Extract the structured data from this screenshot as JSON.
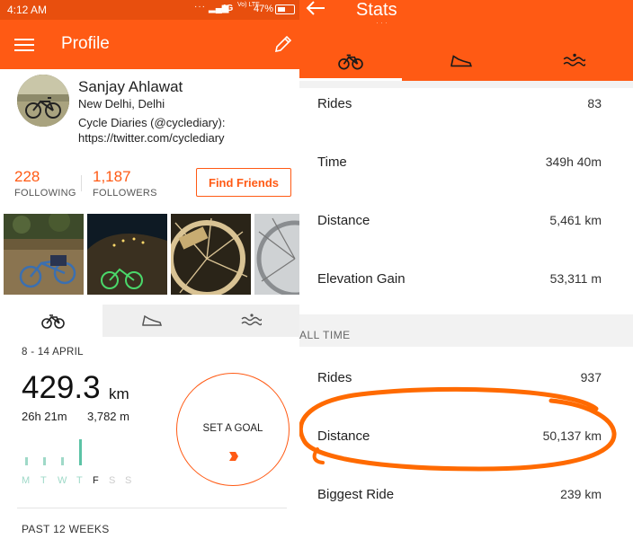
{
  "status_bar": {
    "time": "4:12 AM",
    "network": "4G",
    "volte": "Vo) LTE",
    "battery": "47%"
  },
  "profile_screen": {
    "title": "Profile",
    "athlete": {
      "name": "Sanjay Ahlawat",
      "location": "New Delhi, Delhi",
      "bio_line1": "Cycle Diaries (@cyclediary):",
      "bio_line2": "https://twitter.com/cyclediary"
    },
    "following": {
      "count": "228",
      "label": "FOLLOWING"
    },
    "followers": {
      "count": "1,187",
      "label": "FOLLOWERS"
    },
    "find_friends_label": "Find Friends",
    "activity_tabs": [
      {
        "icon": "bike-icon",
        "selected": true
      },
      {
        "icon": "shoe-icon",
        "selected": false
      },
      {
        "icon": "swim-icon",
        "selected": false
      }
    ],
    "week": {
      "range": "8 - 14 APRIL",
      "distance": "429.3",
      "distance_unit": "km",
      "moving_time": "26h 21m",
      "elevation": "3,782 m",
      "days": [
        "M",
        "T",
        "W",
        "T",
        "F",
        "S",
        "S"
      ],
      "goal_label": "SET A GOAL"
    },
    "past_weeks_label": "PAST 12 WEEKS"
  },
  "stats_screen": {
    "title": "Stats",
    "tabs": [
      {
        "icon": "bike-icon",
        "selected": true
      },
      {
        "icon": "shoe-icon",
        "selected": false
      },
      {
        "icon": "swim-icon",
        "selected": false
      }
    ],
    "recent": [
      {
        "label": "Rides",
        "value": "83"
      },
      {
        "label": "Time",
        "value": "349h 40m"
      },
      {
        "label": "Distance",
        "value": "5,461 km"
      },
      {
        "label": "Elevation Gain",
        "value": "53,311 m"
      }
    ],
    "all_time_title": "ALL TIME",
    "all_time": [
      {
        "label": "Rides",
        "value": "937"
      },
      {
        "label": "Distance",
        "value": "50,137 km"
      },
      {
        "label": "Biggest Ride",
        "value": "239 km"
      }
    ]
  },
  "colors": {
    "brand": "#ff5a14",
    "status_bar": "#e84f0e",
    "annotation": "#ff6a00",
    "goal_bar": "#5cc3a6"
  }
}
